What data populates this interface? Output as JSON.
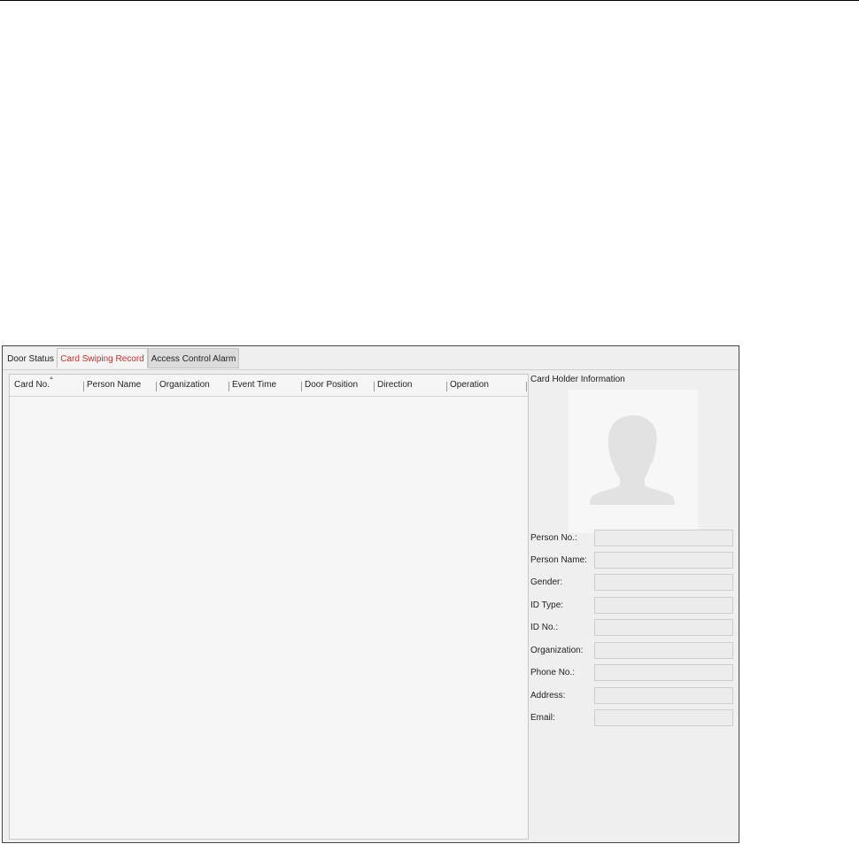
{
  "tabs": [
    {
      "label": "Door Status",
      "active": false
    },
    {
      "label": "Card Swiping Record",
      "active": true
    },
    {
      "label": "Access Control Alarm",
      "active": false
    }
  ],
  "table": {
    "columns": [
      "Card No.",
      "Person Name",
      "Organization",
      "Event Time",
      "Door Position",
      "Direction",
      "Operation"
    ],
    "sorted_column": "Card No.",
    "rows": []
  },
  "card_holder": {
    "title": "Card Holder Information",
    "photo_icon": "person-silhouette-icon",
    "fields": [
      {
        "label": "Person No.:",
        "value": ""
      },
      {
        "label": "Person Name:",
        "value": ""
      },
      {
        "label": "Gender:",
        "value": ""
      },
      {
        "label": "ID Type:",
        "value": ""
      },
      {
        "label": "ID No.:",
        "value": ""
      },
      {
        "label": "Organization:",
        "value": ""
      },
      {
        "label": "Phone No.:",
        "value": ""
      },
      {
        "label": "Address:",
        "value": ""
      },
      {
        "label": "Email:",
        "value": ""
      }
    ]
  },
  "colors": {
    "active_tab_text": "#c9302c",
    "panel_background": "#efefef",
    "table_background": "#f5f5f5"
  }
}
